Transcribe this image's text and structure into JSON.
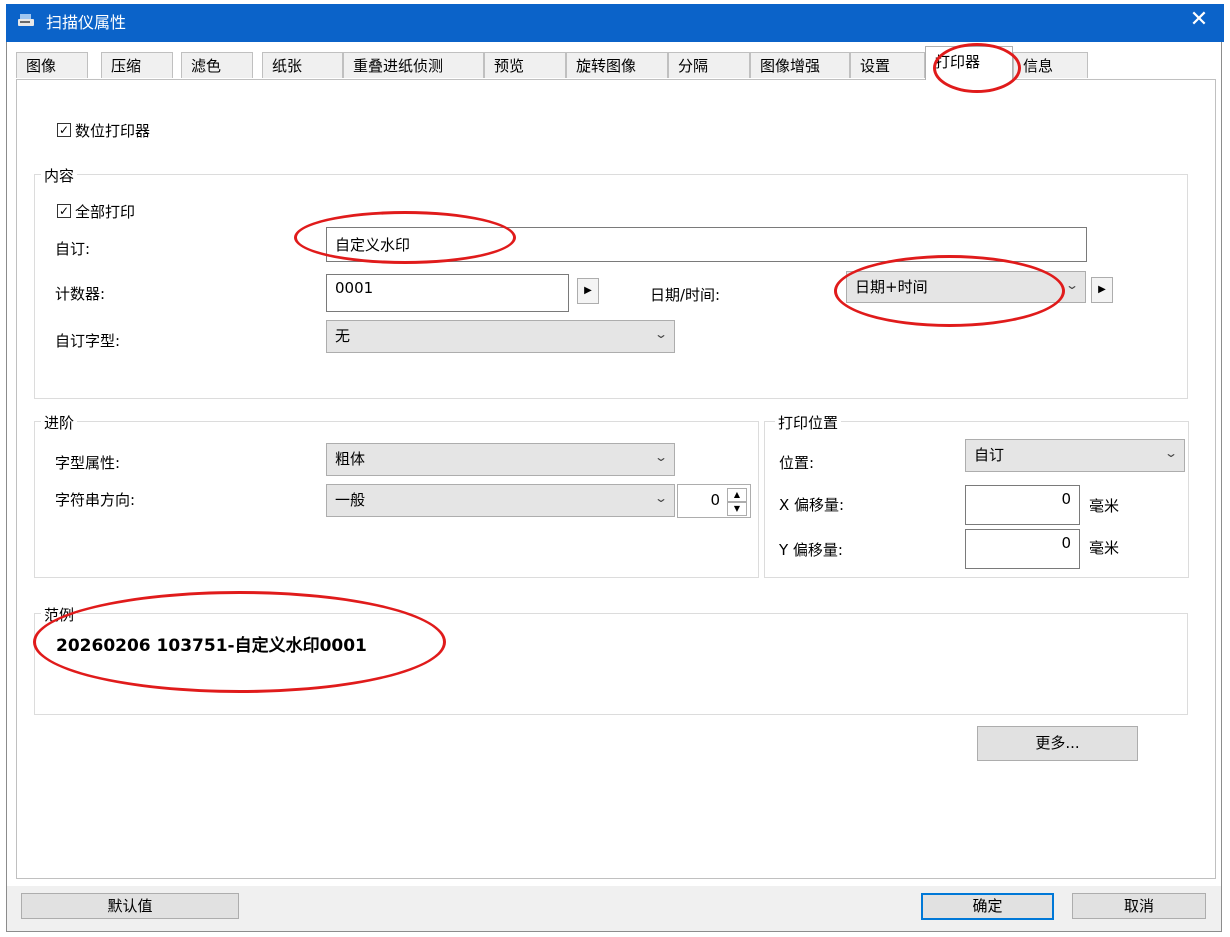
{
  "window": {
    "title": "扫描仪属性",
    "close": "✕"
  },
  "tabs": [
    "图像",
    "压缩",
    "滤色",
    "纸张",
    "重叠进纸侦测",
    "预览",
    "旋转图像",
    "分隔",
    "图像增强",
    "设置",
    "打印器",
    "信息"
  ],
  "active_tab": "打印器",
  "digital_printer": {
    "label": "数位打印器",
    "checked": true
  },
  "content": {
    "title": "内容",
    "print_all": {
      "label": "全部打印",
      "checked": true
    },
    "custom_label": "自订:",
    "custom_value": "自定义水印",
    "counter_label": "计数器:",
    "counter_value": "0001",
    "datetime_label": "日期/时间:",
    "datetime_value": "日期+时间",
    "custom_font_label": "自订字型:",
    "custom_font_value": "无"
  },
  "advanced": {
    "title": "进阶",
    "font_attr_label": "字型属性:",
    "font_attr_value": "粗体",
    "direction_label": "字符串方向:",
    "direction_value": "一般",
    "angle_value": "0"
  },
  "print_position": {
    "title": "打印位置",
    "position_label": "位置:",
    "position_value": "自订",
    "x_label": "X 偏移量:",
    "x_value": "0",
    "x_unit": "毫米",
    "y_label": "Y 偏移量:",
    "y_value": "0",
    "y_unit": "毫米"
  },
  "sample": {
    "title": "范例",
    "text": "20260206 103751-自定义水印0001"
  },
  "buttons": {
    "more": "更多...",
    "default": "默认值",
    "ok": "确定",
    "cancel": "取消"
  },
  "annotation_color": "#e01b1b",
  "icons": {
    "title_icon": "scanner-icon",
    "chevron": "chevron-down-icon",
    "arrow": "triangle-right-icon"
  }
}
